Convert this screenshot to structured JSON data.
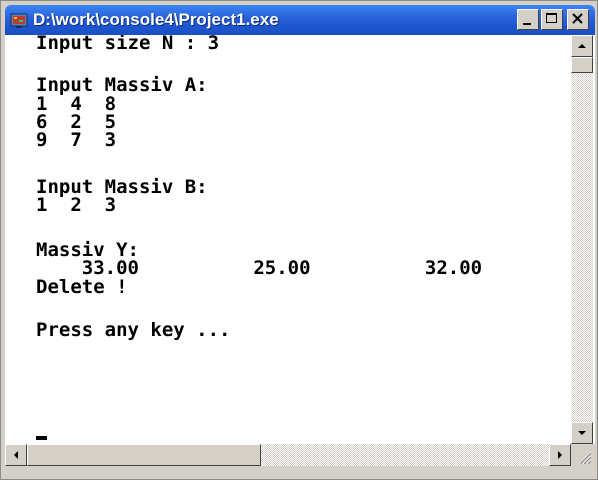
{
  "window": {
    "title": "D:\\work\\console4\\Project1.exe",
    "icon": "console-app-icon"
  },
  "titlebar_buttons": {
    "minimize": "minimize-icon",
    "maximize": "maximize-icon",
    "close": "close-icon"
  },
  "console": {
    "lines": [
      "Input size N : 3",
      "",
      "Input Massiv A:",
      "1  4  8",
      "6  2  5",
      "9  7  3",
      "",
      "Input Massiv B:",
      "1  2  3",
      "",
      "Massiv Y:",
      "    33.00          25.00          32.00",
      "Delete !",
      "",
      "Press any key ..."
    ]
  },
  "colors": {
    "titlebar": "#2a63dc",
    "console_bg": "#ffffff",
    "console_text": "#000000",
    "chrome": "#d4d0c8"
  }
}
